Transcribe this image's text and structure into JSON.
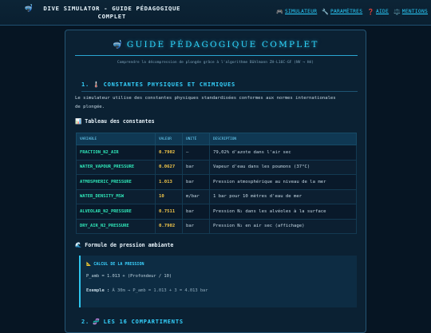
{
  "header": {
    "icon": "diver-mask-icon",
    "title": "DIVE SIMULATOR - GUIDE PÉDAGOGIQUE COMPLET",
    "nav": [
      {
        "icon": "🎮",
        "label": "SIMULATEUR"
      },
      {
        "icon": "🔧",
        "label": "PARAMÈTRES"
      },
      {
        "icon": "❓",
        "label": "AIDE"
      },
      {
        "icon": "⚖️",
        "label": "MENTIONS"
      }
    ]
  },
  "page": {
    "title_icon": "diver-mask-icon",
    "title": "GUIDE PÉDAGOGIQUE COMPLET",
    "subtitle": "Comprendre la décompression de plongée grâce à l'algorithme Bühlmann ZH-L16C-GF (NV → Hé)"
  },
  "section1": {
    "number": "1.",
    "icon": "🌡️",
    "title": "CONSTANTES PHYSIQUES ET CHIMIQUES",
    "intro": "Le simulateur utilise des constantes physiques standardisées conformes aux normes internationales de plongée."
  },
  "constants_table": {
    "heading_icon": "📊",
    "heading": "Tableau des constantes",
    "columns": [
      "VARIABLE",
      "VALEUR",
      "UNITÉ",
      "DESCRIPTION"
    ],
    "rows": [
      {
        "variable": "FRACTION_N2_AIR",
        "value": "0.7902",
        "unit": "–",
        "description": "79,02% d'azote dans l'air sec"
      },
      {
        "variable": "WATER_VAPOUR_PRESSURE",
        "value": "0.0627",
        "unit": "bar",
        "description": "Vapeur d'eau dans les poumons (37°C)"
      },
      {
        "variable": "ATMOSPHERIC_PRESSURE",
        "value": "1.013",
        "unit": "bar",
        "description": "Pression atmosphérique au niveau de la mer"
      },
      {
        "variable": "WATER_DENSITY_MSW",
        "value": "10",
        "unit": "m/bar",
        "description": "1 bar pour 10 mètres d'eau de mer"
      },
      {
        "variable": "ALVEOLAR_N2_PRESSURE",
        "value": "0.7511",
        "unit": "bar",
        "description": "Pression N₂ dans les alvéoles à la surface"
      },
      {
        "variable": "DRY_AIR_N2_PRESSURE",
        "value": "0.7902",
        "unit": "bar",
        "description": "Pression N₂ en air sec (affichage)"
      }
    ]
  },
  "pressure": {
    "heading_icon": "🌊",
    "heading": "Formule de pression ambiante",
    "callout_icon": "📐",
    "callout_title": "CALCUL DE LA PRESSION",
    "formula": "P_amb = 1.013 + (Profondeur / 10)",
    "example_label": "Exemple :",
    "example": "À 30m → P_amb = 1.013 + 3 = 4.013 bar"
  },
  "section2": {
    "number": "2.",
    "icon": "🧬",
    "title": "LES 16 COMPARTIMENTS"
  }
}
